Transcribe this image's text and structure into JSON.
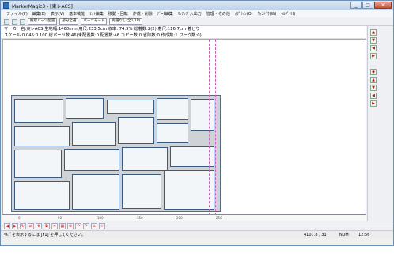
{
  "window": {
    "title": "MarkerMagic3 - [東レACS]",
    "buttons": {
      "minimize": "_",
      "maximize": "□",
      "close": "✕"
    }
  },
  "menu": {
    "items": [
      "ファイル(F)",
      "編集(E)",
      "表示(V)",
      "基本機能",
      "ｾｯﾄ編集",
      "移動・回転",
      "作成・削除",
      "ﾃﾞｰﾀ編集",
      "ﾏｯﾁﾝｸﾞ入出力",
      "管理・その他",
      "ｵﾌﾟｼｮﾝ(O)",
      "ｳｨﾝﾄﾞｳ(W)",
      "ﾍﾙﾌﾟ(H)"
    ]
  },
  "toolbar": {
    "select1": "掘取パーツ配置",
    "select2": "部分全選",
    "select3": "パーツモード",
    "select4": "再選なし(全1/1P)"
  },
  "info": {
    "line1": "マーカー名:東レACS 生地幅:1460mm 用尺:233.5cm 収率: 74.5% 総着数:2(2) 着尺:116.7cm 着どり",
    "line2": "スケール 0.045:0.100 総パーツ数:46(未配置数:0 配置数:46 コピー数:0 省除数:0 作成数:1 ワーク数:0)"
  },
  "ruler": {
    "ticks": [
      "0",
      "50",
      "100",
      "150",
      "200",
      "250"
    ]
  },
  "status": {
    "help": "ﾍﾙﾌﾟを表示するには [F1] を押してください。",
    "coords": "4107.8 , 31",
    "num": "NUM",
    "time": "12:56"
  },
  "icons": {
    "app": "marker-app-icon",
    "rightbar": [
      "arrow-up-icon",
      "arrow-down-icon",
      "arrow-left-icon",
      "arrow-right-icon"
    ]
  }
}
